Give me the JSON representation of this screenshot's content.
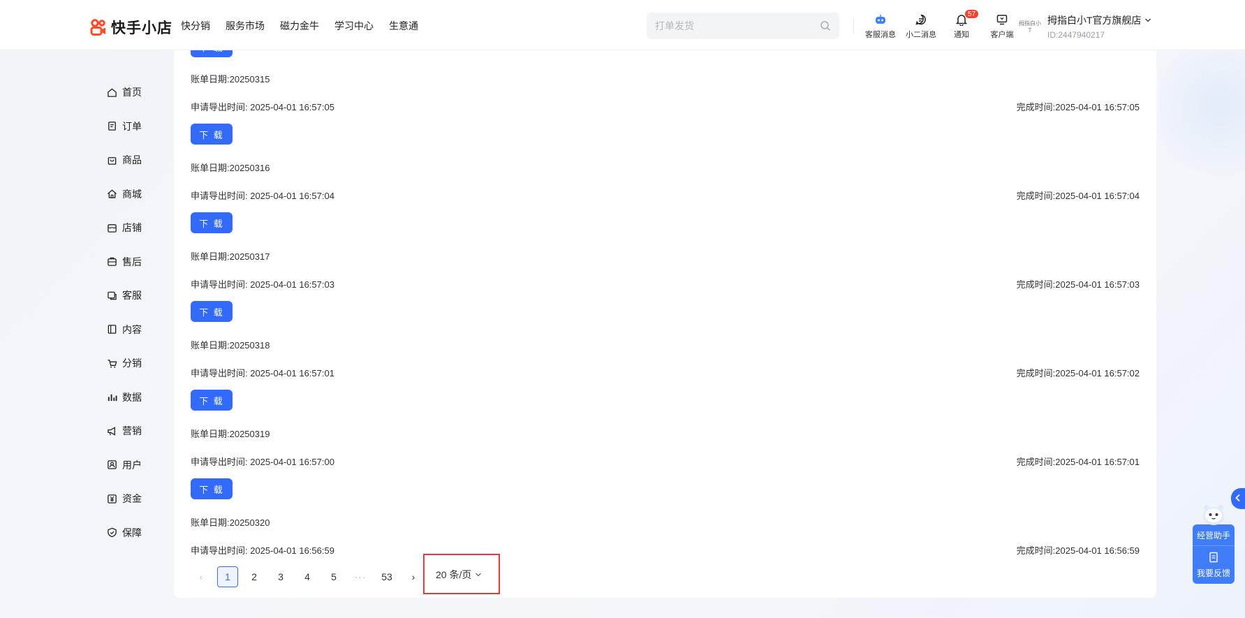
{
  "header": {
    "logo_text": "快手小店",
    "nav": [
      "快分销",
      "服务市场",
      "磁力金牛",
      "学习中心",
      "生意通"
    ],
    "search_placeholder": "打单发货",
    "tools": [
      {
        "label": "客服消息",
        "icon": "robot-icon"
      },
      {
        "label": "小二消息",
        "icon": "chat-icon"
      },
      {
        "label": "通知",
        "icon": "bell-icon",
        "badge": "57"
      },
      {
        "label": "客户端",
        "icon": "monitor-icon"
      }
    ],
    "shop": {
      "logo_text": "拇指白小T",
      "name": "拇指白小T官方旗舰店",
      "id": "ID:2447940217"
    }
  },
  "sidebar": {
    "items": [
      {
        "label": "首页",
        "icon": "home-icon"
      },
      {
        "label": "订单",
        "icon": "order-icon"
      },
      {
        "label": "商品",
        "icon": "bag-icon"
      },
      {
        "label": "商城",
        "icon": "mall-icon"
      },
      {
        "label": "店铺",
        "icon": "store-icon"
      },
      {
        "label": "售后",
        "icon": "aftersale-icon"
      },
      {
        "label": "客服",
        "icon": "service-icon"
      },
      {
        "label": "内容",
        "icon": "content-icon"
      },
      {
        "label": "分销",
        "icon": "distribution-icon"
      },
      {
        "label": "数据",
        "icon": "data-icon"
      },
      {
        "label": "营销",
        "icon": "megaphone-icon"
      },
      {
        "label": "用户",
        "icon": "user-icon"
      },
      {
        "label": "资金",
        "icon": "money-icon"
      },
      {
        "label": "保障",
        "icon": "shield-icon"
      }
    ]
  },
  "main": {
    "download_label": "下 载",
    "partial_top_button": "下 载",
    "records": [
      {
        "bill_date": "账单日期:20250315",
        "apply_time": "申请导出时间: 2025-04-01 16:57:05",
        "done_time": "完成时间:2025-04-01 16:57:05"
      },
      {
        "bill_date": "账单日期:20250316",
        "apply_time": "申请导出时间: 2025-04-01 16:57:04",
        "done_time": "完成时间:2025-04-01 16:57:04"
      },
      {
        "bill_date": "账单日期:20250317",
        "apply_time": "申请导出时间: 2025-04-01 16:57:03",
        "done_time": "完成时间:2025-04-01 16:57:03"
      },
      {
        "bill_date": "账单日期:20250318",
        "apply_time": "申请导出时间: 2025-04-01 16:57:01",
        "done_time": "完成时间:2025-04-01 16:57:02"
      },
      {
        "bill_date": "账单日期:20250319",
        "apply_time": "申请导出时间: 2025-04-01 16:57:00",
        "done_time": "完成时间:2025-04-01 16:57:01"
      },
      {
        "bill_date": "账单日期:20250320",
        "apply_time": "申请导出时间: 2025-04-01 16:56:59",
        "done_time": "完成时间:2025-04-01 16:56:59"
      }
    ]
  },
  "pagination": {
    "prev": "‹",
    "pages": [
      "1",
      "2",
      "3",
      "4",
      "5"
    ],
    "ellipsis": "···",
    "last": "53",
    "next": "›",
    "current": "1",
    "page_size": "20 条/页"
  },
  "widgets": {
    "assistant_label": "经营助手",
    "feedback_label": "我要反馈"
  },
  "colors": {
    "primary": "#326bfb",
    "logo": "#fe4a25",
    "highlight_box": "#e23b3b",
    "badge": "#f5402c"
  }
}
